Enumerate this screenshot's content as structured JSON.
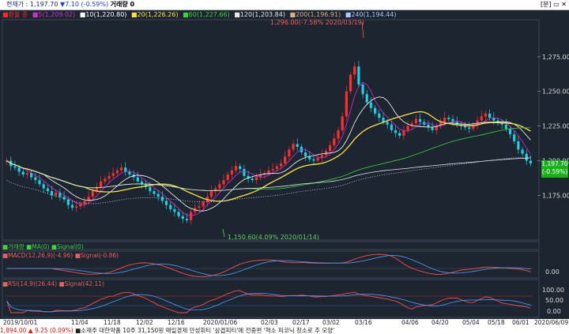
{
  "topbar": {
    "price_label": "현재가 : 1,197.70",
    "change": "▼7.10 (-0.59%)",
    "volume": "거래량 0",
    "buttons": "[분] ▭ ✕"
  },
  "ma_legend": [
    {
      "text": "■환율 종",
      "color": "#ff2a2a"
    },
    {
      "text": "■5(1,209.02)",
      "color": "#d030d0"
    },
    {
      "text": "■10(1,220.80)",
      "color": "#ffffff"
    },
    {
      "text": "■20(1,226.26)",
      "color": "#ffe24a"
    },
    {
      "text": "■60(1,227.66)",
      "color": "#40d040"
    },
    {
      "text": "■120(1,203.84)",
      "color": "#e8e8e8"
    },
    {
      "text": "■200(1,196.91)",
      "color": "#d8b08a"
    },
    {
      "text": "■240(1,194.44)",
      "color": "#a8c8ff"
    }
  ],
  "annotations": {
    "high": "1,296.00(-7.58% 2020/03/19)",
    "low": "1,150.60(4.09% 2020/01/14)"
  },
  "price_tag": {
    "price": "1,197.70",
    "pct": "(-0.59%)"
  },
  "volume_legend": {
    "text": "■거래량 ■MA(0) ■Signal(0)"
  },
  "macd_legend": {
    "text": "■MACD(12,26,9)(-4.96) ■Signal(-0.86)",
    "value": "0.00"
  },
  "rsi_legend": {
    "text": "■RSI(14,9)(26.44) ■Signal(42.11)",
    "v100": "100.00",
    "v50": "50.00",
    "v0": "0.00"
  },
  "dates": [
    "2019/10/01",
    "11/04",
    "11/18",
    "12/02",
    "12/16",
    "2020/01/06",
    "02/03",
    "02/17",
    "03/02",
    "03/16",
    "04/06",
    "04/20",
    "05/04",
    "05/18",
    "06/01",
    "2020/06/09"
  ],
  "ticker": {
    "left_value": "1,894.00 ▲",
    "left_change": "9.25 (0.09%)",
    "news": "■소재주 대한약품 10주 31,150원    매일경제 안성휘티 '삼겹피티'에 전중편 '혁소 피코닉 창소로 추 모양'"
  },
  "chart_data": [
    {
      "type": "candlestick",
      "title": "",
      "xlabel": "",
      "ylabel": "",
      "x_tick_labels": [
        "2019/10/01",
        "11/04",
        "11/18",
        "12/02",
        "12/16",
        "2020/01/06",
        "02/03",
        "02/17",
        "03/02",
        "03/16",
        "04/06",
        "04/20",
        "05/04",
        "05/18",
        "06/01"
      ],
      "y_tick_labels": [
        "1,175.00",
        "1,200.00",
        "1,225.00",
        "1,250.00",
        "1,275.00"
      ],
      "ylim": [
        1145,
        1300
      ],
      "grid": false,
      "closes": [
        1200,
        1196,
        1195,
        1192,
        1190,
        1191,
        1188,
        1186,
        1183,
        1180,
        1178,
        1175,
        1177,
        1174,
        1172,
        1168,
        1166,
        1167,
        1169,
        1171,
        1174,
        1178,
        1181,
        1185,
        1187,
        1189,
        1191,
        1193,
        1195,
        1192,
        1190,
        1188,
        1185,
        1183,
        1181,
        1178,
        1176,
        1174,
        1171,
        1168,
        1165,
        1163,
        1160,
        1158,
        1157,
        1163,
        1166,
        1167,
        1170,
        1174,
        1178,
        1180,
        1183,
        1186,
        1190,
        1193,
        1196,
        1194,
        1189,
        1187,
        1186,
        1188,
        1190,
        1191,
        1193,
        1194,
        1196,
        1198,
        1203,
        1208,
        1212,
        1210,
        1206,
        1203,
        1201,
        1200,
        1202,
        1204,
        1207,
        1211,
        1216,
        1222,
        1232,
        1250,
        1262,
        1268,
        1255,
        1248,
        1242,
        1238,
        1234,
        1231,
        1228,
        1226,
        1222,
        1220,
        1218,
        1222,
        1225,
        1227,
        1230,
        1228,
        1226,
        1224,
        1222,
        1225,
        1228,
        1231,
        1230,
        1228,
        1226,
        1225,
        1224,
        1223,
        1226,
        1229,
        1232,
        1234,
        1231,
        1229,
        1227,
        1226,
        1223,
        1219,
        1214,
        1208,
        1205,
        1200,
        1198
      ]
    },
    {
      "type": "line",
      "title": "",
      "series": [
        {
          "name": "MACD(12,26,9)",
          "values": [
            -4.96
          ]
        },
        {
          "name": "Signal",
          "values": [
            -0.86
          ]
        }
      ],
      "y_tick_labels": [
        "0.00"
      ]
    },
    {
      "type": "line",
      "title": "",
      "series": [
        {
          "name": "RSI(14,9)",
          "values": [
            26.44
          ]
        },
        {
          "name": "Signal",
          "values": [
            42.11
          ]
        }
      ],
      "y_tick_labels": [
        "100.00",
        "50.00",
        "0.00"
      ],
      "ylim": [
        0,
        100
      ]
    }
  ]
}
